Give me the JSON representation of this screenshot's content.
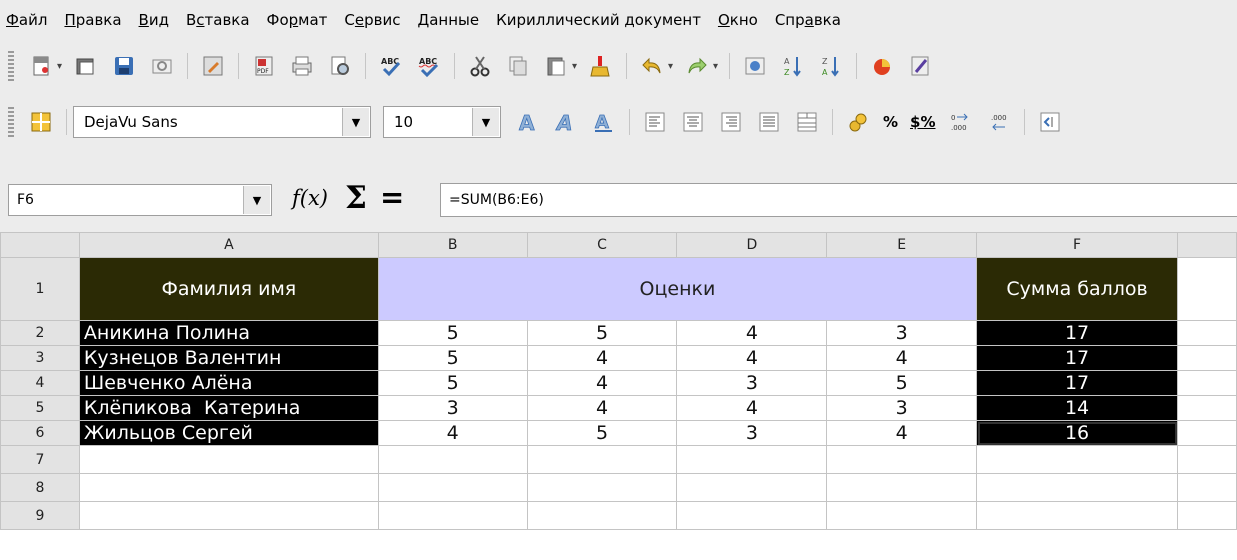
{
  "menu": [
    {
      "pre": "",
      "u": "Ф",
      "post": "айл"
    },
    {
      "pre": "",
      "u": "П",
      "post": "равка"
    },
    {
      "pre": "",
      "u": "В",
      "post": "ид"
    },
    {
      "pre": "В",
      "u": "с",
      "post": "тавка"
    },
    {
      "pre": "Фо",
      "u": "р",
      "post": "мат"
    },
    {
      "pre": "С",
      "u": "е",
      "post": "рвис"
    },
    {
      "pre": "",
      "u": "Д",
      "post": "анные"
    },
    {
      "pre": "Кириллический документ",
      "u": "",
      "post": ""
    },
    {
      "pre": "",
      "u": "О",
      "post": "кно"
    },
    {
      "pre": "Спр",
      "u": "а",
      "post": "вка"
    }
  ],
  "toolbar2": {
    "font_name": "DejaVu Sans",
    "font_size": "10",
    "percent": "%",
    "currency": "$%"
  },
  "formula_bar": {
    "cell_ref": "F6",
    "fx": "f(x)",
    "sigma": "Σ",
    "equals": "=",
    "formula": "=SUM(B6:E6)"
  },
  "columns": [
    "A",
    "B",
    "C",
    "D",
    "E",
    "F"
  ],
  "header_row": {
    "row": "1",
    "a": "Фамилия имя",
    "bcde": "Оценки",
    "f": "Сумма баллов"
  },
  "rows": [
    {
      "row": "2",
      "name": "Аникина Полина",
      "b": "5",
      "c": "5",
      "d": "4",
      "e": "3",
      "f": "17"
    },
    {
      "row": "3",
      "name": "Кузнецов Валентин",
      "b": "5",
      "c": "4",
      "d": "4",
      "e": "4",
      "f": "17"
    },
    {
      "row": "4",
      "name": "Шевченко Алёна",
      "b": "5",
      "c": "4",
      "d": "3",
      "e": "5",
      "f": "17"
    },
    {
      "row": "5",
      "name": "Клёпикова  Катерина",
      "b": "3",
      "c": "4",
      "d": "4",
      "e": "3",
      "f": "14"
    },
    {
      "row": "6",
      "name": "Жильцов Сергей",
      "b": "4",
      "c": "5",
      "d": "3",
      "e": "4",
      "f": "16"
    }
  ],
  "empty_rows": [
    "7",
    "8",
    "9"
  ],
  "colors": {
    "header_dark": "#2b2a05",
    "header_lavender": "#cccaff",
    "name_bg": "#000000"
  }
}
